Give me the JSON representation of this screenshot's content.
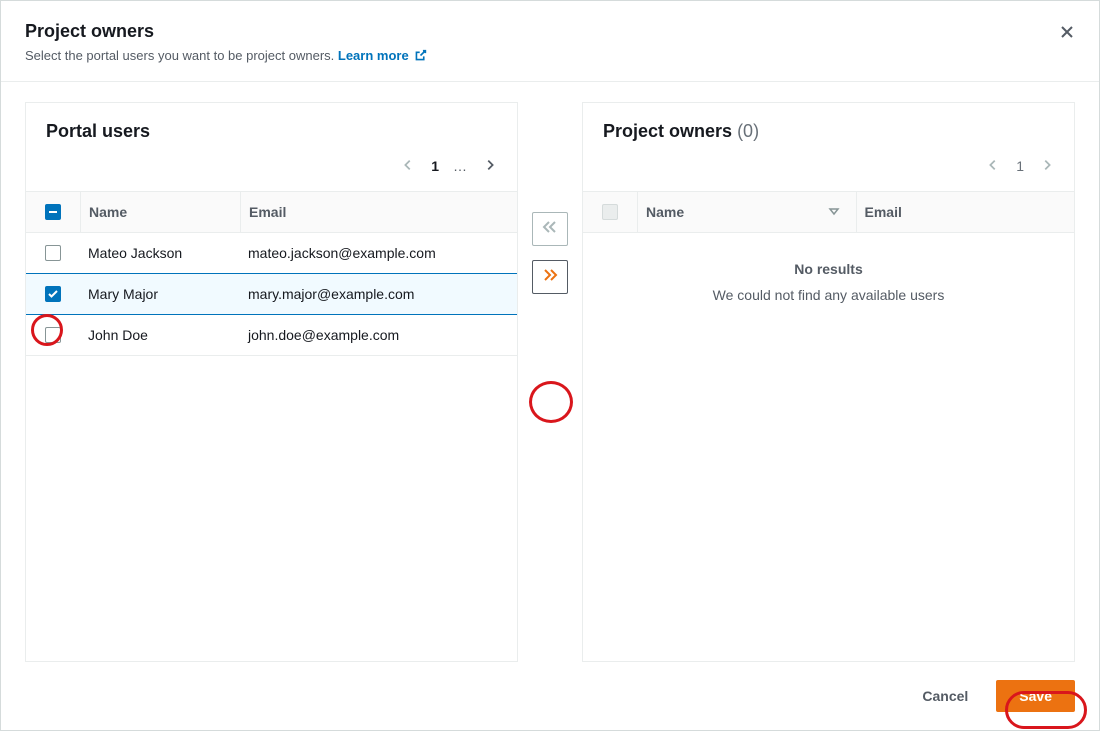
{
  "header": {
    "title": "Project owners",
    "subtitle_prefix": "Select the portal users you want to be project owners. ",
    "learn_more": "Learn more"
  },
  "left_panel": {
    "title": "Portal users",
    "columns": {
      "name": "Name",
      "email": "Email"
    },
    "pagination": {
      "page": "1",
      "ellipsis": "…"
    },
    "rows": [
      {
        "name": "Mateo Jackson",
        "email": "mateo.jackson@example.com",
        "checked": false
      },
      {
        "name": "Mary Major",
        "email": "mary.major@example.com",
        "checked": true
      },
      {
        "name": "John Doe",
        "email": "john.doe@example.com",
        "checked": false
      }
    ]
  },
  "right_panel": {
    "title_prefix": "Project owners",
    "count_display": "(0)",
    "columns": {
      "name": "Name",
      "email": "Email"
    },
    "pagination": {
      "page": "1"
    },
    "empty_title": "No results",
    "empty_msg": "We could not find any available users"
  },
  "footer": {
    "cancel": "Cancel",
    "save": "Save"
  }
}
